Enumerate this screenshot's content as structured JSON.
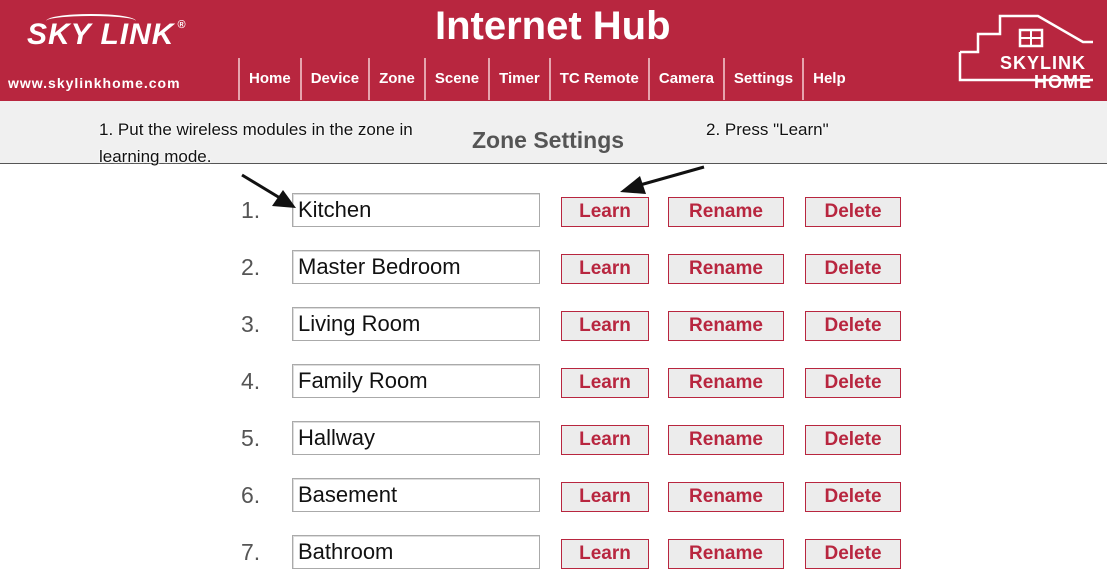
{
  "header": {
    "logo_text": "SKY LINK",
    "logo_mark": "®",
    "url": "www.skylinkhome.com",
    "title": "Internet Hub",
    "brand_line1": "SKYLINK",
    "brand_line2": "HOME",
    "brand_color": "#b8263f"
  },
  "nav": [
    {
      "label": "Home"
    },
    {
      "label": "Device"
    },
    {
      "label": "Zone"
    },
    {
      "label": "Scene"
    },
    {
      "label": "Timer"
    },
    {
      "label": "TC Remote"
    },
    {
      "label": "Camera"
    },
    {
      "label": "Settings"
    },
    {
      "label": "Help"
    }
  ],
  "page": {
    "title": "Zone Settings"
  },
  "annotations": {
    "step1": "1. Put the wireless modules in the zone in learning mode.",
    "step2": "2. Press \"Learn\""
  },
  "buttons": {
    "learn": "Learn",
    "rename": "Rename",
    "delete": "Delete"
  },
  "zones": [
    {
      "num": "1.",
      "name": "Kitchen"
    },
    {
      "num": "2.",
      "name": "Master Bedroom"
    },
    {
      "num": "3.",
      "name": "Living Room"
    },
    {
      "num": "4.",
      "name": "Family Room"
    },
    {
      "num": "5.",
      "name": "Hallway"
    },
    {
      "num": "6.",
      "name": "Basement"
    },
    {
      "num": "7.",
      "name": "Bathroom"
    }
  ]
}
